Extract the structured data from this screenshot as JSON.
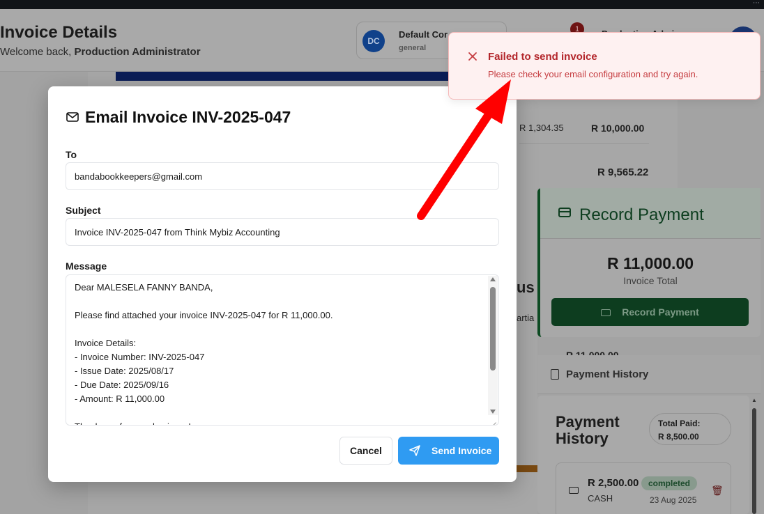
{
  "header": {
    "title": "Invoice Details",
    "welcome_prefix": "Welcome back,",
    "welcome_user": "Production Administrator",
    "company_initials": "DC",
    "company_name": "Default Cor",
    "company_type": "general",
    "notification_count": "1",
    "user_name": "Production Admin"
  },
  "background": {
    "table_values": [
      "R 1,304.35",
      "R 10,000.00"
    ],
    "total": "R 9,565.22",
    "partial_text": "us",
    "partial_text2": "artia",
    "partial_amount": "R 11,000.00"
  },
  "record_payment": {
    "title": "Record Payment",
    "amount": "R 11,000.00",
    "amount_label": "Invoice Total",
    "button_label": "Record Payment"
  },
  "payment_history": {
    "tab_label": "Payment History",
    "title": "Payment History",
    "total_paid_label": "Total Paid:",
    "total_paid_value": "R 8,500.00",
    "item": {
      "amount": "R 2,500.00",
      "method": "CASH",
      "status": "completed",
      "date": "23 Aug 2025"
    }
  },
  "modal": {
    "title": "Email Invoice INV-2025-047",
    "to_label": "To",
    "to_value": "bandabookkeepers@gmail.com",
    "subject_label": "Subject",
    "subject_value": "Invoice INV-2025-047 from Think Mybiz Accounting",
    "message_label": "Message",
    "message_value": "Dear MALESELA FANNY BANDA,\n\nPlease find attached your invoice INV-2025-047 for R 11,000.00.\n\nInvoice Details:\n- Invoice Number: INV-2025-047\n- Issue Date: 2025/08/17\n- Due Date: 2025/09/16\n- Amount: R 11,000.00\n\nThank you for your business!",
    "cancel_label": "Cancel",
    "send_label": "Send Invoice"
  },
  "toast": {
    "title": "Failed to send invoice",
    "message": "Please check your email configuration and try again."
  },
  "colors": {
    "send_button": "#2f9bf2",
    "toast_bg": "#fef1f1",
    "toast_text": "#b3262b",
    "arrow": "#ff0000"
  }
}
